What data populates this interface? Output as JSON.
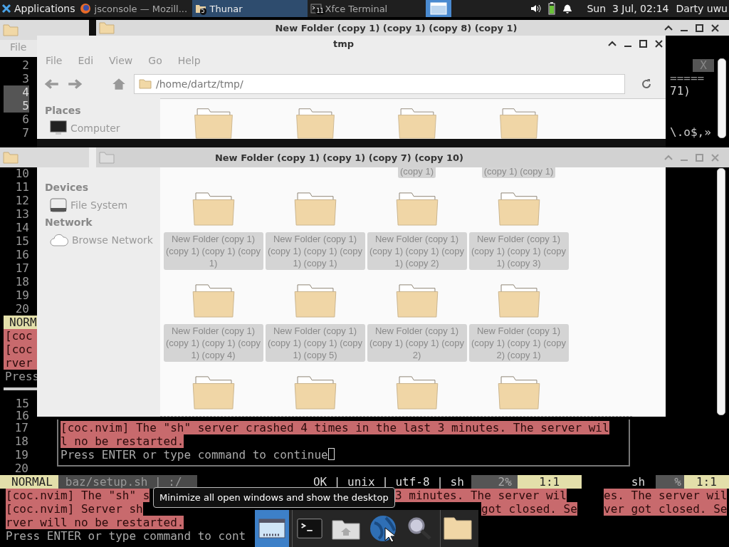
{
  "panel": {
    "menu": "Applications",
    "tasks": [
      {
        "kind": "browser",
        "label": "jsconsole — Mozill...",
        "selected": false
      },
      {
        "kind": "folder",
        "label": "Thunar",
        "badge": "5",
        "selected": true
      },
      {
        "kind": "terminal",
        "label": "Xfce Terminal",
        "badge": "11",
        "selected": false
      }
    ],
    "show_desktop": {
      "pressed": true
    },
    "clock": "Sun  3 Jul, 02:14",
    "user": "Darty uwu"
  },
  "left_terminal": {
    "lines_top": [
      {
        "number": "2",
        "highlighted": false
      },
      {
        "number": "3",
        "highlighted": false
      },
      {
        "number": "4",
        "highlighted": true
      },
      {
        "number": "5",
        "highlighted": true
      },
      {
        "number": "6",
        "highlighted": false
      },
      {
        "number": "7",
        "highlighted": false
      }
    ],
    "lines_bottom": [
      {
        "number": "10",
        "highlighted": false
      },
      {
        "number": "11",
        "highlighted": false
      },
      {
        "number": "12",
        "highlighted": false
      },
      {
        "number": "13",
        "highlighted": false
      },
      {
        "number": "14",
        "highlighted": false
      },
      {
        "number": "15",
        "highlighted": false
      },
      {
        "number": "16",
        "highlighted": false
      },
      {
        "number": "17",
        "highlighted": false
      },
      {
        "number": "18",
        "highlighted": false
      },
      {
        "number": "19",
        "highlighted": false
      },
      {
        "number": "20",
        "highlighted": false
      }
    ],
    "mode": "NORM",
    "messages": [
      "[coc",
      "[coc",
      "rver"
    ],
    "prompt": "Press",
    "pane_lines": [
      "15",
      "16"
    ]
  },
  "left_window": {
    "menu": "File"
  },
  "back_window": {
    "title": "New Folder (copy 1) (copy 1) (copy 8) (copy 1)"
  },
  "right_terminal": {
    "close_label": "X",
    "lines": [
      "=====",
      "71)",
      "\\.o$,»"
    ]
  },
  "file_manager": {
    "title": "tmp",
    "menu": [
      "File",
      "Edi",
      "View",
      "Go",
      "Help"
    ],
    "path": "/home/dartz/tmp/",
    "sidebar": [
      {
        "heading": "Places",
        "items": [
          {
            "kind": "computer",
            "label": "Computer"
          }
        ]
      },
      {
        "heading": "Devices",
        "items": [
          {
            "kind": "disk",
            "label": "File System"
          }
        ]
      },
      {
        "heading": "Network",
        "items": [
          {
            "kind": "network",
            "label": "Browse Network"
          }
        ]
      }
    ],
    "folders": [
      {
        "kind": "folder"
      },
      {
        "kind": "folder"
      },
      {
        "kind": "folder"
      },
      {
        "kind": "folder"
      }
    ]
  },
  "front_window": {
    "title": "New Folder (copy 1) (copy 1) (copy 7) (copy 10)",
    "folders": [
      {
        "kind": "scrolled"
      },
      {
        "kind": "scrolled"
      },
      {
        "kind": "scrolled",
        "label": "(copy 1)",
        "selected": true
      },
      {
        "kind": "scrolled",
        "label": "(copy 1) (copy 1)",
        "selected": true
      },
      {
        "kind": "folder",
        "label": "New Folder (copy 1) (copy 1) (copy 1) (copy 1)",
        "selected": true
      },
      {
        "kind": "folder",
        "label": "New Folder (copy 1) (copy 1) (copy 1) (copy 1) (copy 1)",
        "selected": true
      },
      {
        "kind": "folder",
        "label": "New Folder (copy 1) (copy 1) (copy 1) (copy 1) (copy 2)",
        "selected": true
      },
      {
        "kind": "folder",
        "label": "New Folder (copy 1) (copy 1) (copy 1) (copy 1) (copy 3)",
        "selected": true
      },
      {
        "kind": "folder",
        "label": "New Folder (copy 1) (copy 1) (copy 1) (copy 1) (copy 4)",
        "selected": true
      },
      {
        "kind": "folder",
        "label": "New Folder (copy 1) (copy 1) (copy 1) (copy 1) (copy 5)",
        "selected": true
      },
      {
        "kind": "folder",
        "label": "New Folder (copy 1) (copy 1) (copy 1) (copy 2)",
        "selected": true
      },
      {
        "kind": "folder",
        "label": "New Folder (copy 1) (copy 1) (copy 1) (copy 2) (copy 1)",
        "selected": true
      },
      {
        "kind": "folder"
      },
      {
        "kind": "folder"
      },
      {
        "kind": "folder"
      },
      {
        "kind": "folder"
      }
    ]
  },
  "vim": {
    "popup_lines": [
      {
        "number": "17",
        "kind": "error",
        "text": "[coc.nvim] The \"sh\" server crashed 4 times in the last 3 minutes. The server wil"
      },
      {
        "number": "18",
        "kind": "error",
        "text": "l no be restarted."
      },
      {
        "number": "19",
        "kind": "prompt",
        "text": "Press ENTER or type command to continue"
      },
      {
        "number": "20",
        "kind": "blank"
      }
    ],
    "status": {
      "mode": "NORMAL",
      "file": "baz/setup.sh | :/",
      "info": "OK | unix | utf-8 | sh",
      "percent": "2%",
      "position": "1:1"
    },
    "right_status": {
      "filetype": "sh",
      "percent": "%",
      "position": "1:1"
    },
    "messages": [
      {
        "kind": "error",
        "parts": [
          "[coc.nvim] The \"sh\" s",
          "3 minutes. The server wil",
          "es. The server wil"
        ]
      },
      {
        "kind": "error",
        "parts": [
          "[coc.nvim] Server sh",
          "got closed. Se",
          "ver got closed. Se"
        ]
      },
      {
        "kind": "error",
        "parts": [
          "rver will no be restarted."
        ]
      },
      {
        "kind": "prompt",
        "parts": [
          "Press ENTER or type command to cont"
        ]
      }
    ]
  },
  "tooltip": "Minimize all open windows and show the desktop",
  "dock": [
    {
      "kind": "desktop",
      "selected": true
    },
    {
      "kind": "terminal",
      "selected": false
    },
    {
      "kind": "home",
      "selected": false
    },
    {
      "kind": "globe",
      "selected": false
    },
    {
      "kind": "search",
      "selected": false
    },
    {
      "kind": "folder",
      "selected": false
    }
  ]
}
